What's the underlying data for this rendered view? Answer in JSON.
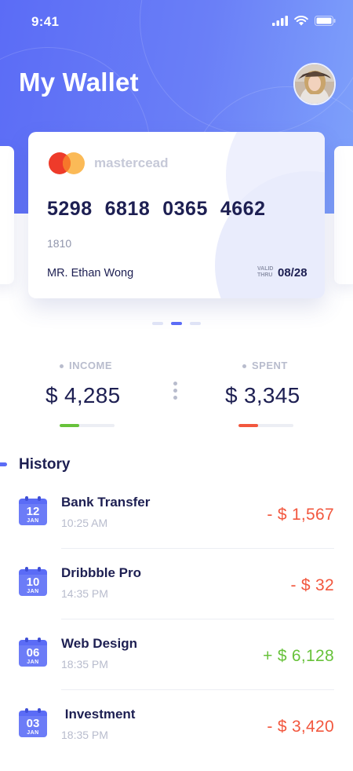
{
  "status_bar": {
    "time": "9:41"
  },
  "header": {
    "title": "My Wallet"
  },
  "card": {
    "brand": "mastercead",
    "number_groups": [
      "5298",
      "6818",
      "0365",
      "4662"
    ],
    "code": "1810",
    "holder": "MR. Ethan Wong",
    "valid_label_1": "VALID",
    "valid_label_2": "THRU",
    "expiry": "08/28"
  },
  "pagination": {
    "count": 3,
    "active_index": 1
  },
  "stats": {
    "income": {
      "label": "INCOME",
      "value": "$ 4,285",
      "progress": 0.35,
      "color": "#67c23a"
    },
    "spent": {
      "label": "SPENT",
      "value": "$ 3,345",
      "progress": 0.35,
      "color": "#f2573e"
    }
  },
  "history": {
    "title": "History",
    "items": [
      {
        "day": "12",
        "month": "JAN",
        "name": "Bank Transfer",
        "time": "10:25 AM",
        "amount": "- $ 1,567",
        "type": "debit"
      },
      {
        "day": "10",
        "month": "JAN",
        "name": "Dribbble Pro",
        "time": "14:35 PM",
        "amount": "- $ 32",
        "type": "debit"
      },
      {
        "day": "06",
        "month": "JAN",
        "name": "Web Design",
        "time": "18:35 PM",
        "amount": "+ $ 6,128",
        "type": "credit"
      },
      {
        "day": "03",
        "month": "JAN",
        "name": " Investment",
        "time": "18:35 PM",
        "amount": "- $ 3,420",
        "type": "debit"
      }
    ]
  },
  "colors": {
    "accent": "#5b6cf6",
    "debit": "#f2573e",
    "credit": "#67c23a",
    "text_dark": "#1d1f52",
    "text_muted": "#b8bccd"
  },
  "icons": {
    "card_brand": "mastercard-logo-icon",
    "signal": "cellular-signal-icon",
    "wifi": "wifi-icon",
    "battery": "battery-icon",
    "calendar": "calendar-icon",
    "more": "more-vertical-icon"
  }
}
